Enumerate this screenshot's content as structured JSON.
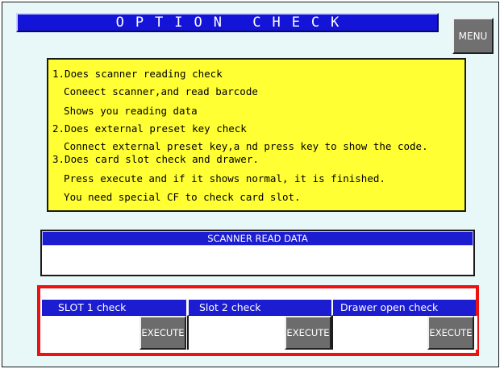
{
  "title": "OPTION CHECK",
  "menu_button": "MENU",
  "instructions": [
    "1.Does scanner reading check",
    "  Coneect scanner,and read barcode",
    "  Shows you reading data",
    "2.Does external preset key check",
    "  Connect external preset key,a nd press key to show the code.",
    "3.Does card slot check and drawer.",
    "  Press execute and if it shows normal, it is finished.",
    "  You need special CF to check card slot."
  ],
  "scanner": {
    "header": "SCANNER READ DATA",
    "value": ""
  },
  "checks": [
    {
      "label": "SLOT 1 check",
      "result": "",
      "button": "EXECUTE"
    },
    {
      "label": "Slot 2 check",
      "result": "",
      "button": "EXECUTE"
    },
    {
      "label": "Drawer open check",
      "result": "",
      "button": "EXECUTE"
    }
  ],
  "colors": {
    "title_bar": "#1414d8",
    "instruction_bg": "#ffff33",
    "highlight_frame": "#ee1111",
    "button": "#6c6c6c"
  }
}
